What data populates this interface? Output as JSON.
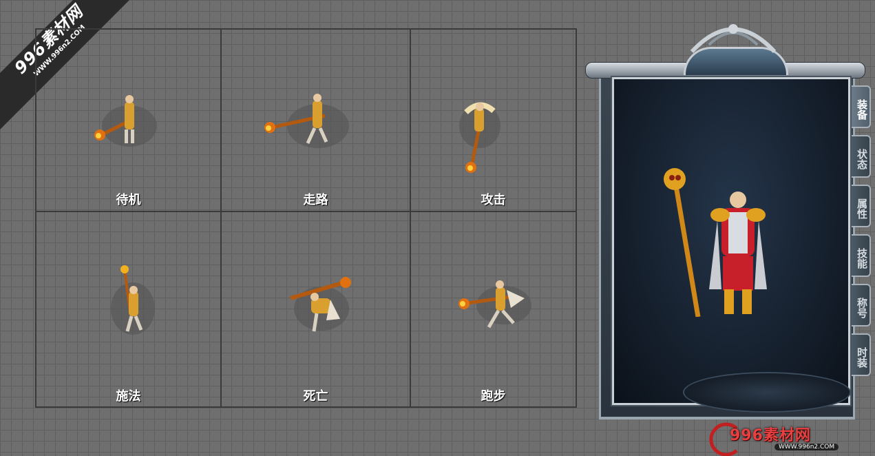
{
  "watermark": {
    "title": "996素材网",
    "url": "WWW.996n2.COM"
  },
  "animations": [
    {
      "label": "待机"
    },
    {
      "label": "走路"
    },
    {
      "label": "攻击"
    },
    {
      "label": "施法"
    },
    {
      "label": "死亡"
    },
    {
      "label": "跑步"
    }
  ],
  "panel": {
    "tabs": [
      {
        "label": "装备"
      },
      {
        "label": "状态"
      },
      {
        "label": "属性"
      },
      {
        "label": "技能"
      },
      {
        "label": "称号"
      },
      {
        "label": "时装"
      }
    ],
    "brand_title": "996素材网",
    "brand_url": "WWW.996n2.COM"
  },
  "colors": {
    "grid_bg": "#6f6f6f",
    "grid_line": "#3a3a3a",
    "panel_frame": "#c9d0d6",
    "panel_inner": "#131c28",
    "brand_red": "#e84040",
    "gold": "#e0a020"
  }
}
